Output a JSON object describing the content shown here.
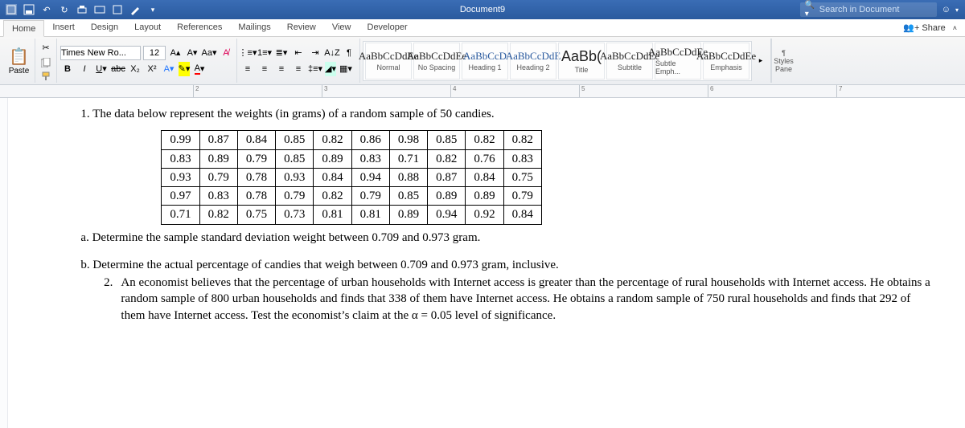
{
  "title": "Document9",
  "search_placeholder": "Search in Document",
  "share_label": "Share",
  "tabs": [
    "Home",
    "Insert",
    "Design",
    "Layout",
    "References",
    "Mailings",
    "Review",
    "View",
    "Developer"
  ],
  "active_tab": 0,
  "clipboard": {
    "paste": "Paste"
  },
  "font": {
    "family": "Times New Ro...",
    "size": "12"
  },
  "styles_pane": "Styles\nPane",
  "styles": [
    {
      "preview": "AaBbCcDdEe",
      "name": "Normal",
      "cls": ""
    },
    {
      "preview": "AaBbCcDdEe",
      "name": "No Spacing",
      "cls": ""
    },
    {
      "preview": "AaBbCcD",
      "name": "Heading 1",
      "cls": "blue"
    },
    {
      "preview": "AaBbCcDdE",
      "name": "Heading 2",
      "cls": "blue"
    },
    {
      "preview": "AaBb(",
      "name": "Title",
      "cls": "big"
    },
    {
      "preview": "AaBbCcDdEe",
      "name": "Subtitle",
      "cls": ""
    },
    {
      "preview": "AaBbCcDdEe",
      "name": "Subtle Emph...",
      "cls": ""
    },
    {
      "preview": "AaBbCcDdEe",
      "name": "Emphasis",
      "cls": ""
    }
  ],
  "ruler_marks": [
    "2",
    "3",
    "4",
    "5",
    "6",
    "7"
  ],
  "doc": {
    "q1_head": "1. The data below represent the weights (in grams) of a random sample of 50 candies.",
    "table": [
      [
        "0.99",
        "0.87",
        "0.84",
        "0.85",
        "0.82",
        "0.86",
        "0.98",
        "0.85",
        "0.82",
        "0.82"
      ],
      [
        "0.83",
        "0.89",
        "0.79",
        "0.85",
        "0.89",
        "0.83",
        "0.71",
        "0.82",
        "0.76",
        "0.83"
      ],
      [
        "0.93",
        "0.79",
        "0.78",
        "0.93",
        "0.84",
        "0.94",
        "0.88",
        "0.87",
        "0.84",
        "0.75"
      ],
      [
        "0.97",
        "0.83",
        "0.78",
        "0.79",
        "0.82",
        "0.79",
        "0.85",
        "0.89",
        "0.89",
        "0.79"
      ],
      [
        "0.71",
        "0.82",
        "0.75",
        "0.73",
        "0.81",
        "0.81",
        "0.89",
        "0.94",
        "0.92",
        "0.84"
      ]
    ],
    "q1a": "a. Determine the sample standard deviation weight between 0.709 and 0.973 gram.",
    "q1b": "b. Determine the actual percentage of candies that weigh between 0.709 and 0.973 gram, inclusive.",
    "q2_num": "2.",
    "q2_body": "An economist believes that the percentage of urban households with Internet access is greater than the percentage of rural households with Internet access. He obtains a random sample of 800 urban households and finds that 338 of them have Internet access. He obtains a random sample of 750 rural households and finds that 292 of them have Internet access. Test the economist’s claim at the α = 0.05 level of significance."
  }
}
